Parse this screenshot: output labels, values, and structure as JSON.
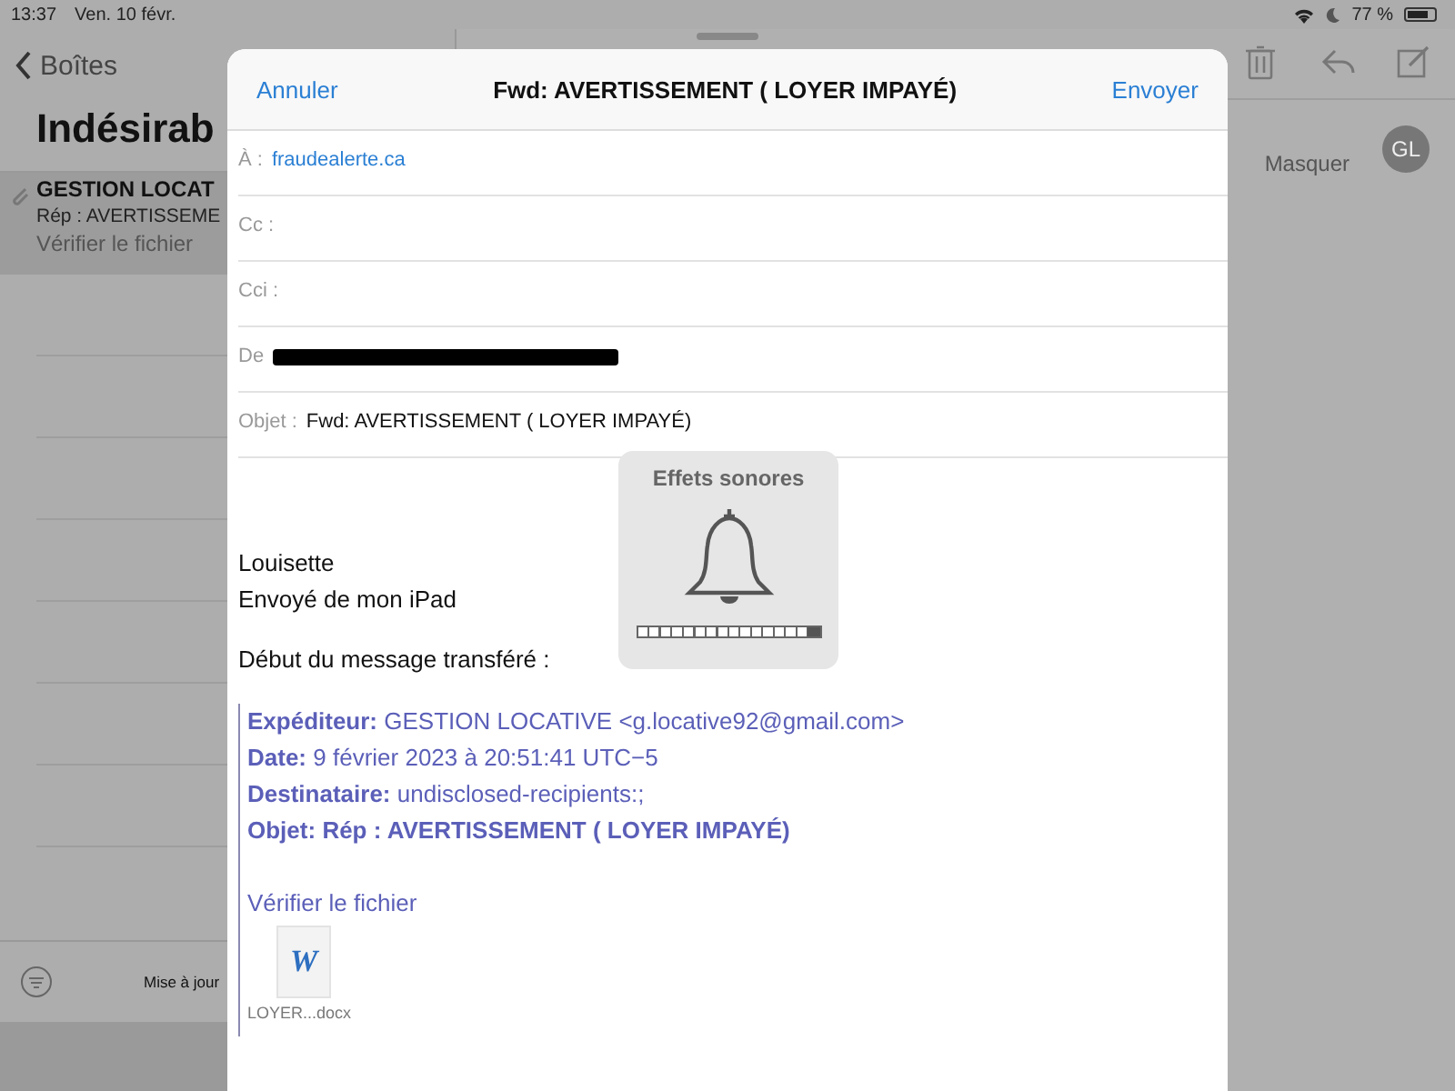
{
  "status_bar": {
    "time": "13:37",
    "date": "Ven. 10 févr.",
    "battery_text": "77 %"
  },
  "mailboxes": {
    "back": "Boîtes",
    "title": "Indésirab",
    "messages": [
      {
        "sender": "GESTION LOCAT",
        "subject": "Rép : AVERTISSEME",
        "preview": "Vérifier le fichier",
        "selected": true
      }
    ],
    "footer": "Mise à jour"
  },
  "reader": {
    "hide": "Masquer",
    "avatar": "GL"
  },
  "compose": {
    "cancel": "Annuler",
    "title": "Fwd: AVERTISSEMENT ( LOYER IMPAYÉ)",
    "send": "Envoyer",
    "fields": [
      {
        "kind": "recipient",
        "label": "À :",
        "value": "fraudealerte.ca"
      },
      {
        "kind": "empty",
        "label": "Cc :"
      },
      {
        "kind": "empty",
        "label": "Cci :"
      },
      {
        "kind": "redacted",
        "label": "De"
      },
      {
        "kind": "subject",
        "label": "Objet :",
        "value": "Fwd: AVERTISSEMENT ( LOYER IMPAYÉ)"
      }
    ],
    "body": [
      "Louisette",
      "Envoyé de mon iPad"
    ],
    "forward_intro": "Début du message transféré :",
    "headers": [
      {
        "label": "Expéditeur:",
        "value": "GESTION LOCATIVE <g.locative92@gmail.com>",
        "bold": false
      },
      {
        "label": "Date:",
        "value": "9 février 2023 à 20:51:41 UTC−5",
        "bold": false
      },
      {
        "label": "Destinataire:",
        "value": "undisclosed-recipients:;",
        "bold": false
      },
      {
        "label": "Objet:",
        "value": "Rép : AVERTISSEMENT ( LOYER IMPAYÉ)",
        "bold": true
      }
    ],
    "quoted_text": "Vérifier le fichier",
    "attachment": {
      "name": "LOYER...docx",
      "letter": "W"
    }
  },
  "sound_hud": {
    "title": "Effets sonores",
    "level": 0.0625
  }
}
